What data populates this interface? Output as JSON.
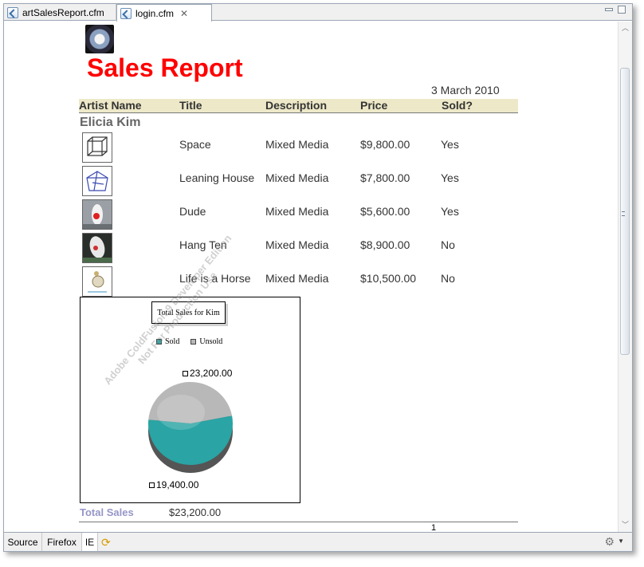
{
  "tabs": [
    {
      "label": "artSalesReport.cfm",
      "active": false
    },
    {
      "label": "login.cfm",
      "active": true
    }
  ],
  "report": {
    "title": "Sales Report",
    "date": "3 March 2010",
    "columns": [
      "Artist Name",
      "Title",
      "Description",
      "Price",
      "Sold?"
    ],
    "artist": "Elicia Kim",
    "rows": [
      {
        "title": "Space",
        "description": "Mixed Media",
        "price": "$9,800.00",
        "sold": "Yes"
      },
      {
        "title": "Leaning House",
        "description": "Mixed Media",
        "price": "$7,800.00",
        "sold": "Yes"
      },
      {
        "title": "Dude",
        "description": "Mixed Media",
        "price": "$5,600.00",
        "sold": "Yes"
      },
      {
        "title": "Hang Ten",
        "description": "Mixed Media",
        "price": "$8,900.00",
        "sold": "No"
      },
      {
        "title": "Life is a Horse",
        "description": "Mixed Media",
        "price": "$10,500.00",
        "sold": "No"
      }
    ],
    "total_label": "Total Sales",
    "total_value": "$23,200.00",
    "page_number": "1"
  },
  "chart_data": {
    "type": "pie",
    "title": "Total Sales for Kim",
    "categories": [
      "Sold",
      "Unsold"
    ],
    "values": [
      23200,
      19400
    ],
    "labels": [
      "23,200.00",
      "19,400.00"
    ],
    "colors": [
      "#2aa4a4",
      "#b8b8b8"
    ],
    "legend": "top"
  },
  "watermark": {
    "line1": "Adobe ColdFusion 9 Developer Edition",
    "line2": "Not For Production Use"
  },
  "bottom_tabs": [
    {
      "label": "Source"
    },
    {
      "label": "Firefox"
    },
    {
      "label": "IE"
    }
  ],
  "icons": {
    "refresh": "refresh-icon",
    "settings": "settings-icon"
  }
}
